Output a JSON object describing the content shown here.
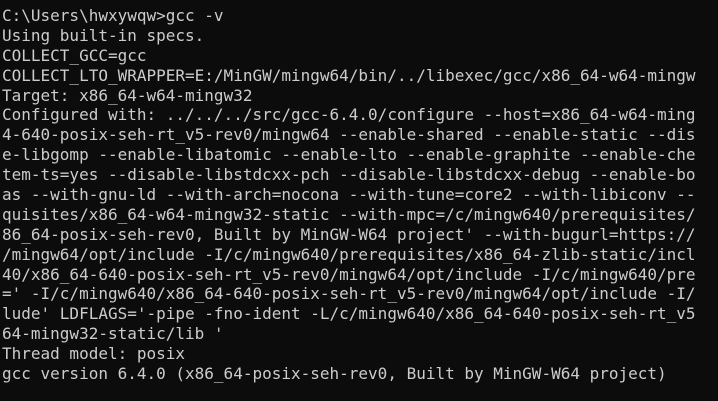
{
  "terminal": {
    "lines": [
      "C:\\Users\\hwxywqw>gcc -v",
      "Using built-in specs.",
      "COLLECT_GCC=gcc",
      "COLLECT_LTO_WRAPPER=E:/MinGW/mingw64/bin/../libexec/gcc/x86_64-w64-mingw",
      "Target: x86_64-w64-mingw32",
      "Configured with: ../../../src/gcc-6.4.0/configure --host=x86_64-w64-ming",
      "4-640-posix-seh-rt_v5-rev0/mingw64 --enable-shared --enable-static --dis",
      "e-libgomp --enable-libatomic --enable-lto --enable-graphite --enable-che",
      "tem-ts=yes --disable-libstdcxx-pch --disable-libstdcxx-debug --enable-bo",
      "as --with-gnu-ld --with-arch=nocona --with-tune=core2 --with-libiconv --",
      "quisites/x86_64-w64-mingw32-static --with-mpc=/c/mingw640/prerequisites/",
      "86_64-posix-seh-rev0, Built by MinGW-W64 project' --with-bugurl=https://",
      "/mingw64/opt/include -I/c/mingw640/prerequisites/x86_64-zlib-static/incl",
      "40/x86_64-640-posix-seh-rt_v5-rev0/mingw64/opt/include -I/c/mingw640/pre",
      "=' -I/c/mingw640/x86_64-640-posix-seh-rt_v5-rev0/mingw64/opt/include -I/",
      "lude' LDFLAGS='-pipe -fno-ident -L/c/mingw640/x86_64-640-posix-seh-rt_v5",
      "64-mingw32-static/lib '",
      "Thread model: posix",
      "gcc version 6.4.0 (x86_64-posix-seh-rev0, Built by MinGW-W64 project)"
    ]
  },
  "colors": {
    "background": "#0c0c0c",
    "foreground": "#cccccc"
  }
}
